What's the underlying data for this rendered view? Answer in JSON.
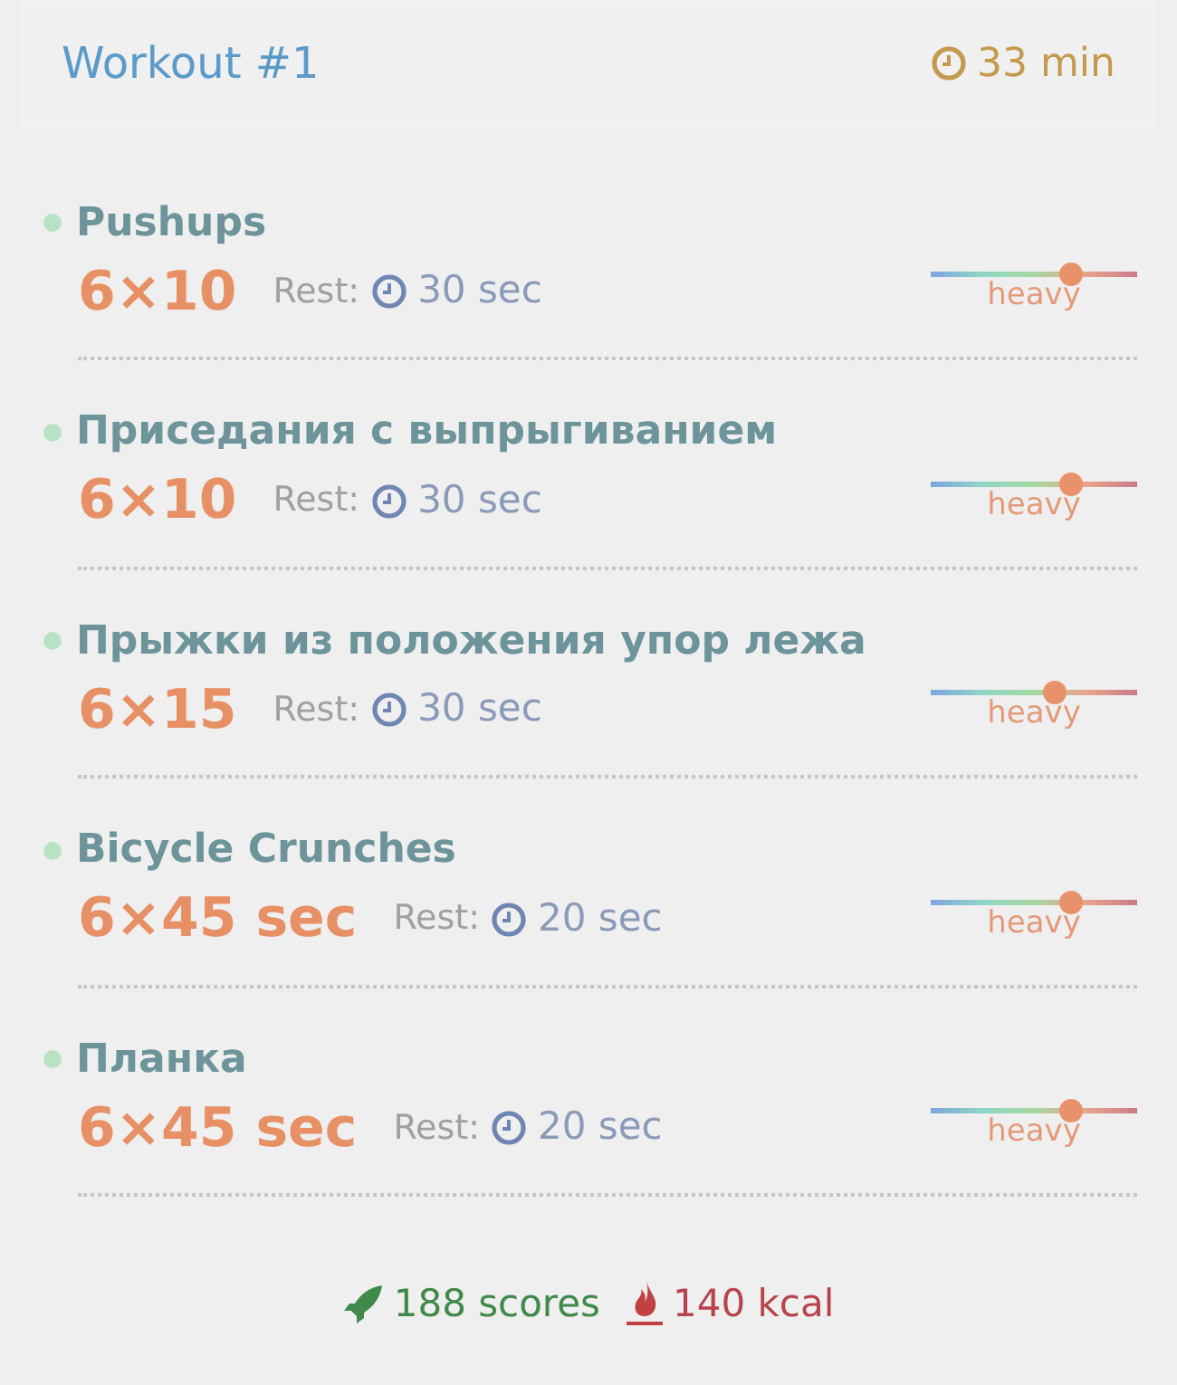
{
  "header": {
    "title": "Workout #1",
    "duration": "33 min"
  },
  "exercises": [
    {
      "name": "Pushups",
      "sets": "6×10",
      "rest_label": "Rest:",
      "rest": "30 sec",
      "level": 0.68,
      "intensity": "heavy"
    },
    {
      "name": "Приседания с выпрыгиванием",
      "sets": "6×10",
      "rest_label": "Rest:",
      "rest": "30 sec",
      "level": 0.68,
      "intensity": "heavy"
    },
    {
      "name": "Прыжки из положения упор лежа",
      "sets": "6×15",
      "rest_label": "Rest:",
      "rest": "30 sec",
      "level": 0.6,
      "intensity": "heavy"
    },
    {
      "name": "Bicycle Crunches",
      "sets": "6×45 sec",
      "rest_label": "Rest:",
      "rest": "20 sec",
      "level": 0.68,
      "intensity": "heavy"
    },
    {
      "name": "Планка",
      "sets": "6×45 sec",
      "rest_label": "Rest:",
      "rest": "20 sec",
      "level": 0.68,
      "intensity": "heavy"
    }
  ],
  "footer": {
    "scores": "188 scores",
    "calories": "140 kcal"
  }
}
